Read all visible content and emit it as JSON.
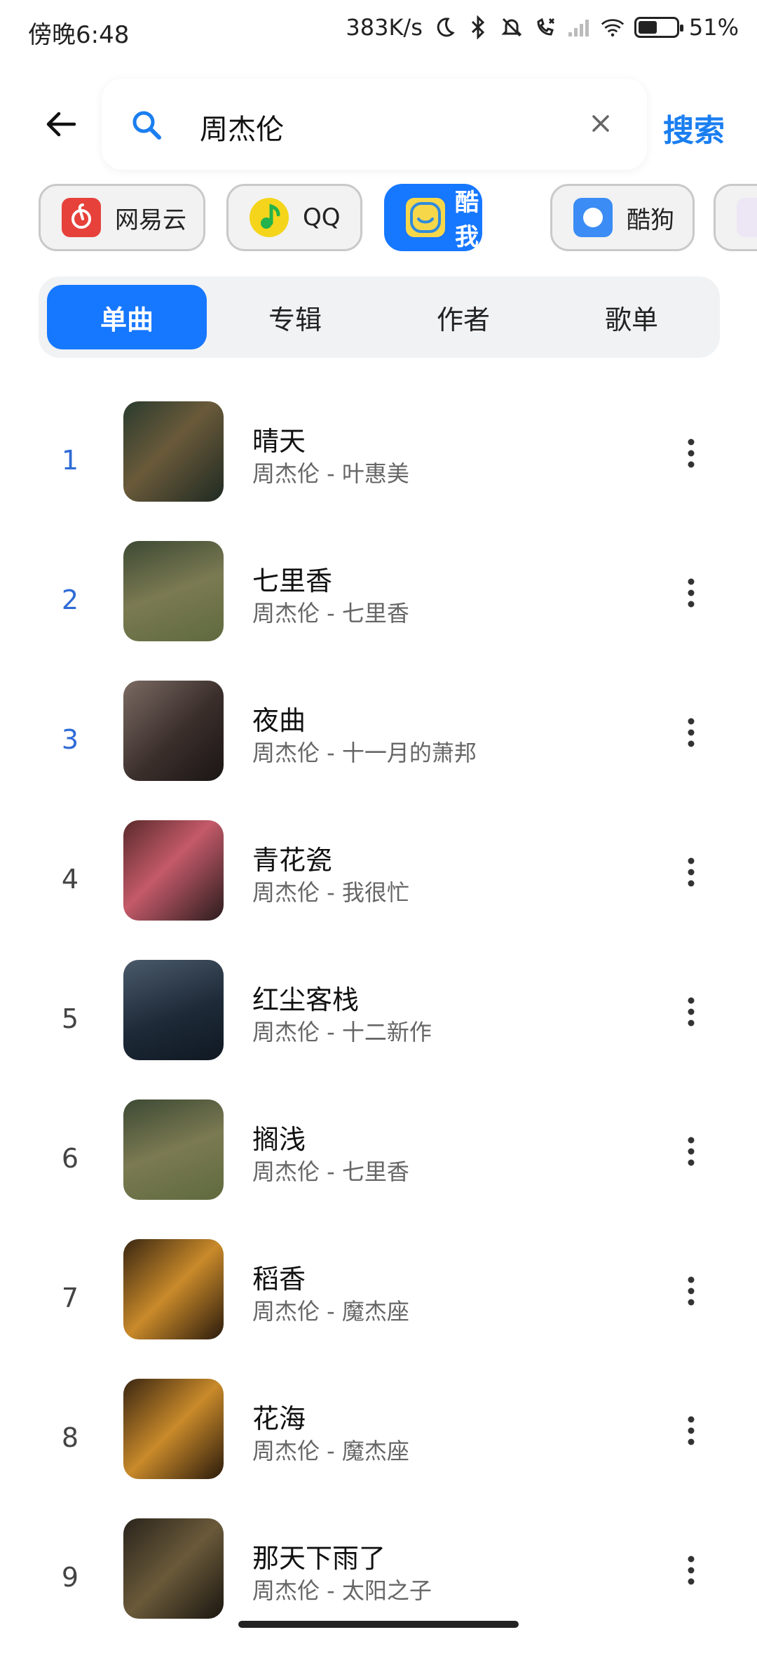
{
  "status_bar": {
    "time": "傍晚6:48",
    "network_speed": "383K/s",
    "battery": "51%",
    "battery_level": 0.51
  },
  "search": {
    "query": "周杰伦",
    "button_label": "搜索"
  },
  "sources": [
    {
      "label": "网易云",
      "color": "#e6413a",
      "active": false
    },
    {
      "label": "QQ",
      "color": "#f5d51b",
      "active": false
    },
    {
      "label": "酷我",
      "color": "#f7d74a",
      "active": true
    },
    {
      "label": "酷狗",
      "color": "#3b8cf5",
      "active": false
    }
  ],
  "tabs": [
    {
      "label": "单曲",
      "active": true
    },
    {
      "label": "专辑",
      "active": false
    },
    {
      "label": "作者",
      "active": false
    },
    {
      "label": "歌单",
      "active": false
    }
  ],
  "songs": [
    {
      "rank": "1",
      "title": "晴天",
      "subtitle": "周杰伦 - 叶惠美"
    },
    {
      "rank": "2",
      "title": "七里香",
      "subtitle": "周杰伦 - 七里香"
    },
    {
      "rank": "3",
      "title": "夜曲",
      "subtitle": "周杰伦 - 十一月的萧邦"
    },
    {
      "rank": "4",
      "title": "青花瓷",
      "subtitle": "周杰伦 - 我很忙"
    },
    {
      "rank": "5",
      "title": "红尘客栈",
      "subtitle": "周杰伦 - 十二新作"
    },
    {
      "rank": "6",
      "title": "搁浅",
      "subtitle": "周杰伦 - 七里香"
    },
    {
      "rank": "7",
      "title": "稻香",
      "subtitle": "周杰伦 - 魔杰座"
    },
    {
      "rank": "8",
      "title": "花海",
      "subtitle": "周杰伦 - 魔杰座"
    },
    {
      "rank": "9",
      "title": "那天下雨了",
      "subtitle": "周杰伦 - 太阳之子"
    }
  ],
  "colors": {
    "accent": "#1677ff",
    "search_button": "#1a7ef0",
    "top_rank": "#2f6bd6"
  }
}
